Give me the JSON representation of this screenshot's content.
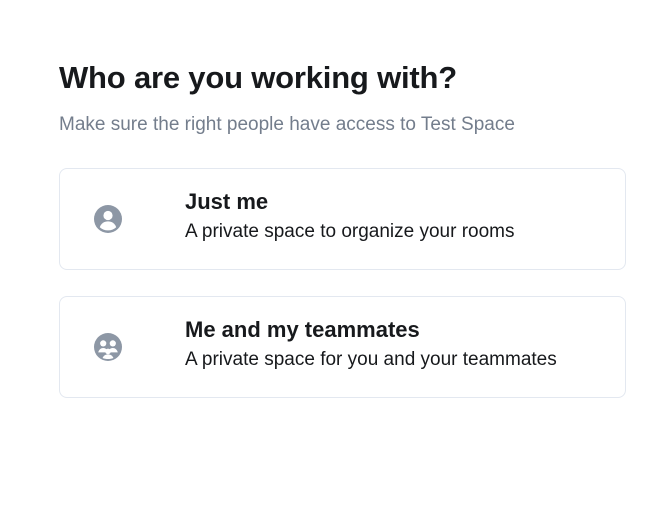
{
  "header": {
    "title": "Who are you working with?",
    "subtitle": "Make sure the right people have access to Test Space"
  },
  "options": [
    {
      "title": "Just me",
      "description": "A private space to organize your rooms",
      "icon": "user-icon"
    },
    {
      "title": "Me and my teammates",
      "description": "A private space for you and your teammates",
      "icon": "group-icon"
    }
  ],
  "colors": {
    "icon": "#8d97a5",
    "border": "#e3e8f0",
    "subtitle": "#737d8c",
    "text": "#17191c"
  }
}
